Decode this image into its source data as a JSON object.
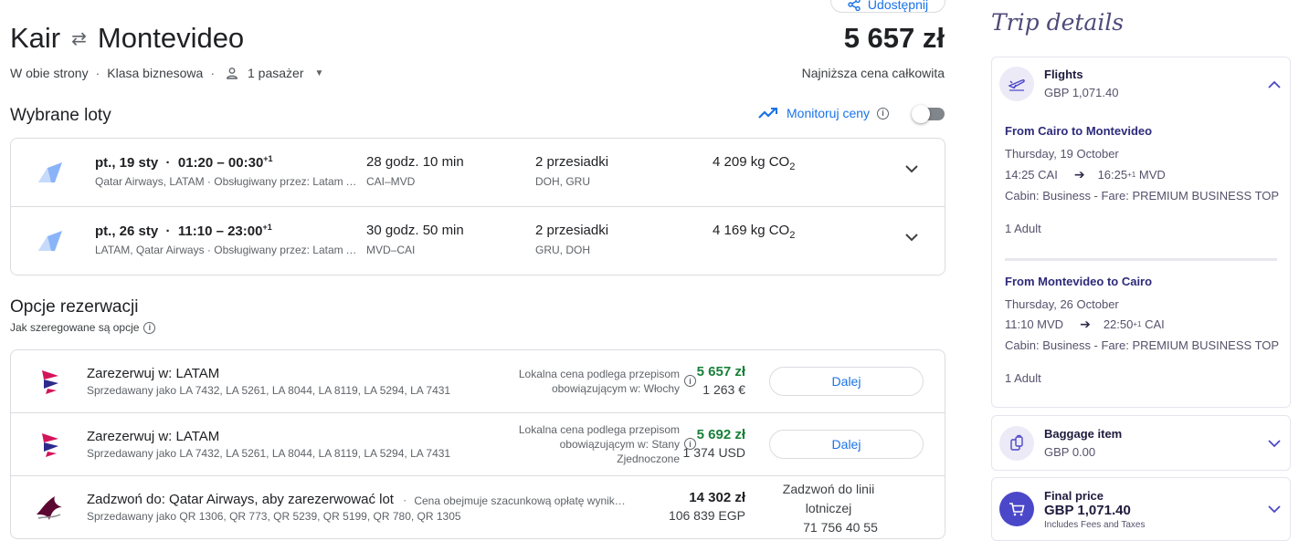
{
  "header": {
    "share_label": "Udostępnij",
    "origin": "Kair",
    "destination": "Montevideo",
    "trip_type": "W obie strony",
    "cabin": "Klasa biznesowa",
    "passengers": "1 pasażer",
    "total_price": "5 657 zł",
    "total_label": "Najniższa cena całkowita"
  },
  "selected": {
    "title": "Wybrane loty",
    "monitor_label": "Monitoruj ceny",
    "monitor_enabled": false,
    "flights": [
      {
        "date": "pt., 19 sty",
        "times": "01:20 – 00:30",
        "day_offset": "+1",
        "airlines": "Qatar Airways, LATAM · Obsługiwany przez: Latam Airlines Brasil",
        "duration": "28 godz. 10 min",
        "route": "CAI–MVD",
        "stops": "2 przesiadki",
        "via": "DOH, GRU",
        "co2_value": "4 209 kg CO",
        "co2_sub": "2"
      },
      {
        "date": "pt., 26 sty",
        "times": "11:10 – 23:00",
        "day_offset": "+1",
        "airlines": "LATAM, Qatar Airways · Obsługiwany przez: Latam Airlines Brasil",
        "duration": "30 godz. 50 min",
        "route": "MVD–CAI",
        "stops": "2 przesiadki",
        "via": "GRU, DOH",
        "co2_value": "4 169 kg CO",
        "co2_sub": "2"
      }
    ]
  },
  "booking": {
    "title": "Opcje rezerwacji",
    "subtitle": "Jak szeregowane są opcje",
    "options": [
      {
        "title": "Zarezerwuj w: LATAM",
        "sold_as": "Sprzedawany jako LA 7432, LA 5261, LA 8044, LA 8119, LA 5294, LA 7431",
        "note_line1": "Lokalna cena podlega przepisom",
        "note_line2": "obowiązującym w: Włochy",
        "note_line3": "",
        "price": "5 657 zł",
        "local_price": "1 263 €",
        "action": "Dalej"
      },
      {
        "title": "Zarezerwuj w: LATAM",
        "sold_as": "Sprzedawany jako LA 7432, LA 5261, LA 8044, LA 8119, LA 5294, LA 7431",
        "note_line1": "Lokalna cena podlega przepisom",
        "note_line2": "obowiązującym w: Stany",
        "note_line3": "Zjednoczone",
        "price": "5 692 zł",
        "local_price": "1 374 USD",
        "action": "Dalej"
      },
      {
        "title": "Zadzwoń do: Qatar Airways, aby zarezerwować lot",
        "title_note": "Cena obejmuje szacunkową opłatę wynikającą z",
        "sold_as": "Sprzedawany jako QR 1306, QR 773, QR 5239, QR 5199, QR 780, QR 1305",
        "price": "14 302 zł",
        "local_price": "106 839 EGP",
        "call_line1": "Zadzwoń do linii",
        "call_line2": "lotniczej",
        "call_phone": "71 756 40 55"
      }
    ]
  },
  "trip": {
    "title": "Trip details",
    "flights": {
      "label": "Flights",
      "price": "GBP 1,071.40",
      "legs": [
        {
          "title": "From Cairo to Montevideo",
          "date": "Thursday, 19 October",
          "dep": "14:25 CAI",
          "arr_time": "16:25",
          "arr_offset": "+1",
          "arr_code": "MVD",
          "cabin": "Cabin: Business - Fare: PREMIUM BUSINESS TOP",
          "pax": "1 Adult"
        },
        {
          "title": "From Montevideo to Cairo",
          "date": "Thursday, 26 October",
          "dep": "11:10 MVD",
          "arr_time": "22:50",
          "arr_offset": "+1",
          "arr_code": "CAI",
          "cabin": "Cabin: Business - Fare: PREMIUM BUSINESS TOP",
          "pax": "1 Adult"
        }
      ]
    },
    "baggage": {
      "label": "Baggage item",
      "price": "GBP 0.00"
    },
    "final": {
      "label": "Final price",
      "price": "GBP 1,071.40",
      "note": "Includes Fees and Taxes"
    }
  },
  "colors": {
    "accent_blue": "#1a73e8",
    "price_green": "#188038",
    "trip_purple": "#4b47c9"
  }
}
